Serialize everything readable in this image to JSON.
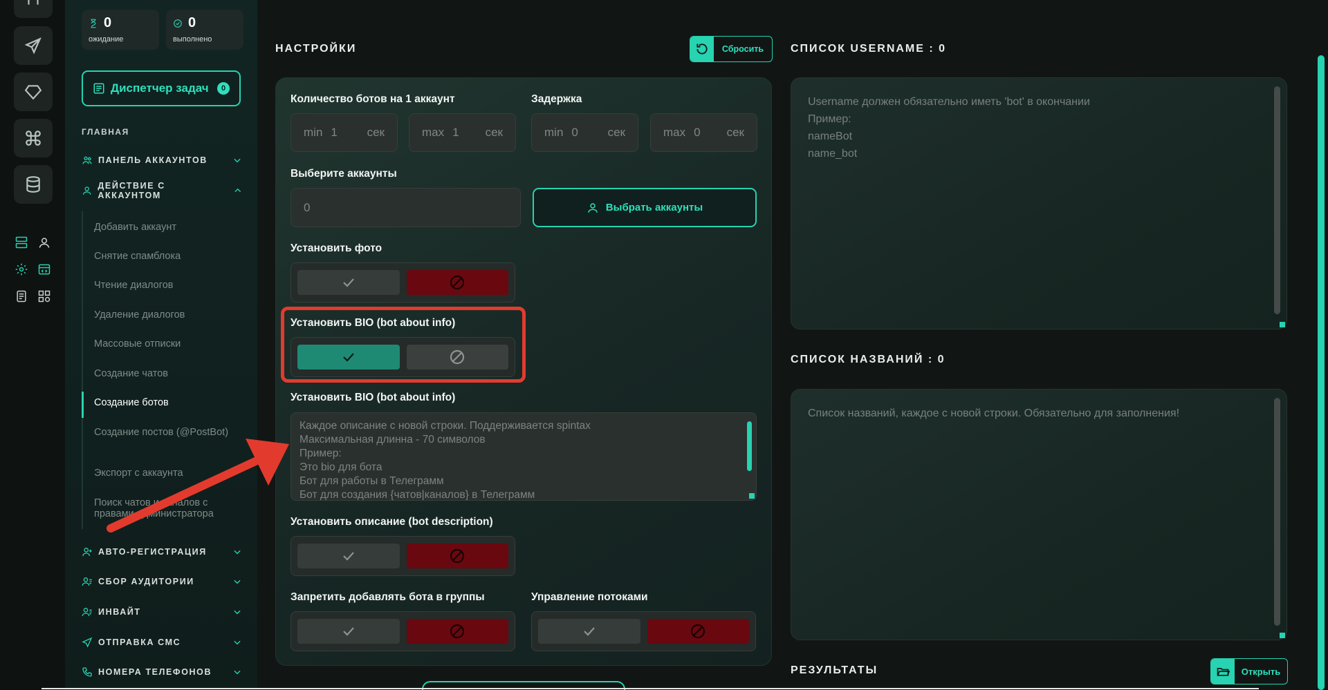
{
  "stats": [
    {
      "value": "0",
      "label": "ожидание",
      "icon": "hourglass-icon"
    },
    {
      "value": "0",
      "label": "выполнено",
      "icon": "check-circle-icon"
    }
  ],
  "task_manager": {
    "label": "Диспетчер задач",
    "badge": "0"
  },
  "sidebar": {
    "section_title": "ГЛАВНАЯ",
    "groups_top": [
      {
        "label": "ПАНЕЛЬ АККАУНТОВ"
      },
      {
        "label": "ДЕЙСТВИЕ С АККАУНТОМ"
      }
    ],
    "sub_items": [
      "Добавить аккаунт",
      "Снятие спамблока",
      "Чтение диалогов",
      "Удаление диалогов",
      "Массовые отписки",
      "Создание чатов",
      "Создание ботов",
      "Создание постов (@PostBot)",
      "Экспорт с аккаунта",
      "Поиск чатов и каналов с правами администратора"
    ],
    "active_item": "Создание ботов",
    "groups_bottom": [
      {
        "label": "АВТО-РЕГИСТРАЦИЯ"
      },
      {
        "label": "СБОР АУДИТОРИИ"
      },
      {
        "label": "ИНВАЙТ"
      },
      {
        "label": "ОТПРАВКА СМС"
      },
      {
        "label": "НОМЕРА ТЕЛЕФОНОВ"
      }
    ]
  },
  "settings": {
    "title": "НАСТРОЙКИ",
    "reset_label": "Сбросить",
    "bots_per_account": {
      "label": "Количество ботов на 1 аккаунт",
      "min_prefix": "min",
      "min_value": "1",
      "min_unit": "сек",
      "max_prefix": "max",
      "max_value": "1",
      "max_unit": "сек"
    },
    "delay": {
      "label": "Задержка",
      "min_prefix": "min",
      "min_value": "0",
      "min_unit": "сек",
      "max_prefix": "max",
      "max_value": "0",
      "max_unit": "сек"
    },
    "accounts": {
      "label": "Выберите аккаунты",
      "value": "0",
      "button": "Выбрать аккаунты"
    },
    "set_photo": {
      "label": "Установить фото",
      "state": "off"
    },
    "set_bio_toggle": {
      "label": "Установить BIO (bot about info)",
      "state": "on"
    },
    "bio_text": {
      "label": "Установить BIO (bot about info)",
      "placeholder_lines": [
        "Каждое описание с новой строки. Поддерживается spintax",
        "Максимальная длинна - 70 символов",
        "Пример:",
        "Это bio для бота",
        "Бот для работы в Телеграмм",
        "Бот для создания {чатов|каналов} в Телеграмм"
      ]
    },
    "set_description": {
      "label": "Установить описание (bot description)",
      "state": "off"
    },
    "forbid_groups": {
      "label": "Запретить добавлять бота в группы",
      "state": "off"
    },
    "threads": {
      "label": "Управление потоками",
      "state": "off"
    }
  },
  "username_list": {
    "title": "СПИСОК USERNAME : 0",
    "placeholder_lines": [
      "Username должен обязательно иметь 'bot' в окончании",
      "Пример:",
      "nameBot",
      "name_bot"
    ]
  },
  "names_list": {
    "title": "СПИСОК НАЗВАНИЙ : 0",
    "placeholder_lines": [
      "Список названий, каждое с новой строки. Обязательно для заполнения!"
    ]
  },
  "results": {
    "title": "РЕЗУЛЬТАТЫ",
    "open_label": "Открыть"
  },
  "colors": {
    "accent": "#27d3b0",
    "danger": "#6a0810",
    "highlight": "#e23b2e"
  }
}
